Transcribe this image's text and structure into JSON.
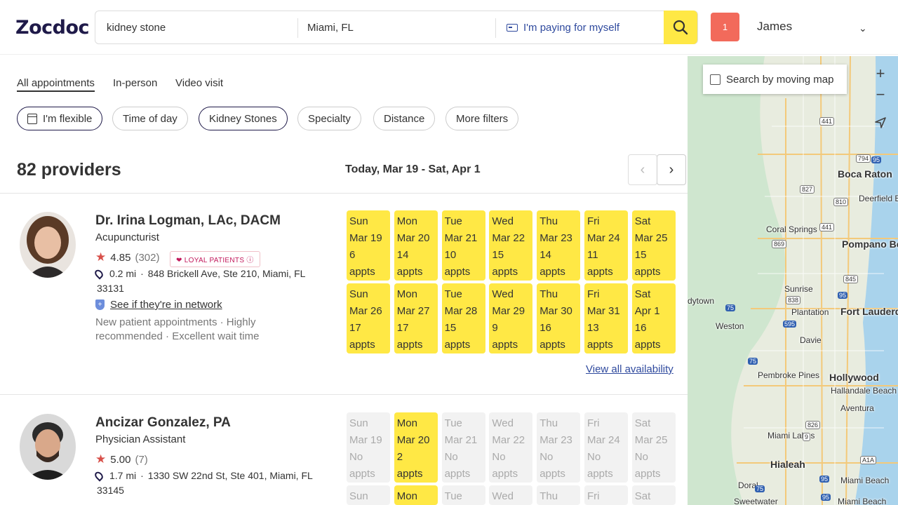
{
  "header": {
    "logo": "Zocdoc",
    "search_value": "kidney stone",
    "location_value": "Miami, FL",
    "insurance_value": "I'm paying for myself",
    "notifications": "1",
    "user_name": "James",
    "accent": "#ffe845"
  },
  "tabs": [
    "All appointments",
    "In-person",
    "Video visit"
  ],
  "filters": [
    "I'm flexible",
    "Time of day",
    "Kidney Stones",
    "Specialty",
    "Distance",
    "More filters"
  ],
  "results": {
    "count": "82 providers",
    "date_range": "Today, Mar 19 - Sat, Apr 1",
    "view_all": "View all availability"
  },
  "providers": [
    {
      "name": "Dr. Irina Logman, LAc, DACM",
      "specialty": "Acupuncturist",
      "rating": "4.85",
      "reviews": "(302)",
      "badge": "LOYAL PATIENTS",
      "distance": "0.2 mi",
      "address": "848 Brickell Ave, Ste 210, Miami, FL",
      "zip": "33131",
      "network": "See if they're in network",
      "note1": "New patient appointments · Highly",
      "note2": "recommended · Excellent wait time",
      "week1": [
        {
          "day": "Sun",
          "date": "Mar 19",
          "count": "6",
          "unit": "appts"
        },
        {
          "day": "Mon",
          "date": "Mar 20",
          "count": "14",
          "unit": "appts"
        },
        {
          "day": "Tue",
          "date": "Mar 21",
          "count": "10",
          "unit": "appts"
        },
        {
          "day": "Wed",
          "date": "Mar 22",
          "count": "15",
          "unit": "appts"
        },
        {
          "day": "Thu",
          "date": "Mar 23",
          "count": "14",
          "unit": "appts"
        },
        {
          "day": "Fri",
          "date": "Mar 24",
          "count": "11",
          "unit": "appts"
        },
        {
          "day": "Sat",
          "date": "Mar 25",
          "count": "15",
          "unit": "appts"
        }
      ],
      "week2": [
        {
          "day": "Sun",
          "date": "Mar 26",
          "count": "17",
          "unit": "appts"
        },
        {
          "day": "Mon",
          "date": "Mar 27",
          "count": "17",
          "unit": "appts"
        },
        {
          "day": "Tue",
          "date": "Mar 28",
          "count": "15",
          "unit": "appts"
        },
        {
          "day": "Wed",
          "date": "Mar 29",
          "count": "9",
          "unit": "appts"
        },
        {
          "day": "Thu",
          "date": "Mar 30",
          "count": "16",
          "unit": "appts"
        },
        {
          "day": "Fri",
          "date": "Mar 31",
          "count": "13",
          "unit": "appts"
        },
        {
          "day": "Sat",
          "date": "Apr 1",
          "count": "16",
          "unit": "appts"
        }
      ]
    },
    {
      "name": "Ancizar Gonzalez, PA",
      "specialty": "Physician Assistant",
      "rating": "5.00",
      "reviews": "(7)",
      "distance": "1.7 mi",
      "address": "1330 SW 22nd St, Ste 401, Miami, FL",
      "zip": "33145",
      "week1": [
        {
          "day": "Sun",
          "date": "Mar 19",
          "count": "No",
          "unit": "appts"
        },
        {
          "day": "Mon",
          "date": "Mar 20",
          "count": "2",
          "unit": "appts"
        },
        {
          "day": "Tue",
          "date": "Mar 21",
          "count": "No",
          "unit": "appts"
        },
        {
          "day": "Wed",
          "date": "Mar 22",
          "count": "No",
          "unit": "appts"
        },
        {
          "day": "Thu",
          "date": "Mar 23",
          "count": "No",
          "unit": "appts"
        },
        {
          "day": "Fri",
          "date": "Mar 24",
          "count": "No",
          "unit": "appts"
        },
        {
          "day": "Sat",
          "date": "Mar 25",
          "count": "No",
          "unit": "appts"
        }
      ],
      "week2_days": [
        "Sun",
        "Mon",
        "Tue",
        "Wed",
        "Thu",
        "Fri",
        "Sat"
      ]
    }
  ],
  "map": {
    "search_label": "Search by moving map",
    "places": [
      "Boca Raton",
      "Deerfield Beach",
      "Coral Springs",
      "Pompano Beach",
      "Sunrise",
      "Plantation",
      "Fort Lauderdale",
      "Weston",
      "Davie",
      "Pembroke Pines",
      "Hollywood",
      "Hallandale Beach",
      "Aventura",
      "Miami Lakes",
      "Hialeah",
      "Doral",
      "Miami Beach",
      "Sweetwater",
      "Miami Beach",
      "dytown"
    ],
    "shields": [
      "441",
      "794",
      "95",
      "827",
      "810",
      "441",
      "869",
      "845",
      "838",
      "75",
      "595",
      "95",
      "75",
      "826",
      "9",
      "A1A",
      "95",
      "95",
      "75"
    ]
  }
}
